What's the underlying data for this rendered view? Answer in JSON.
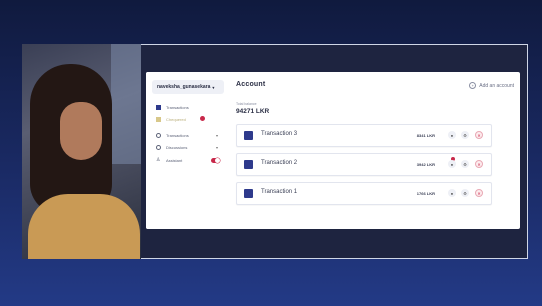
{
  "sidebar": {
    "user_name": "naveksha_gunasekara",
    "items": [
      {
        "label": "Transactions"
      },
      {
        "label": "Chequered"
      },
      {
        "label": "Transactions"
      },
      {
        "label": "Discussions"
      },
      {
        "label": "Assistant"
      }
    ]
  },
  "header": {
    "title": "Account",
    "add_account_label": "Add an account"
  },
  "balance": {
    "label": "Total balance",
    "value": "94271 LKR"
  },
  "transactions": [
    {
      "name": "Transaction 3",
      "amount": "8341 LKR"
    },
    {
      "name": "Transaction 2",
      "amount": "3942 LKR"
    },
    {
      "name": "Transaction 1",
      "amount": "1766 LKR"
    }
  ],
  "colors": {
    "accent": "#2e3a8c",
    "danger": "#c8284a",
    "background": "#1a2a64"
  },
  "icons": {
    "add": "plus-circle-icon",
    "view": "eye-icon",
    "settings": "gear-icon",
    "delete": "close-icon"
  }
}
